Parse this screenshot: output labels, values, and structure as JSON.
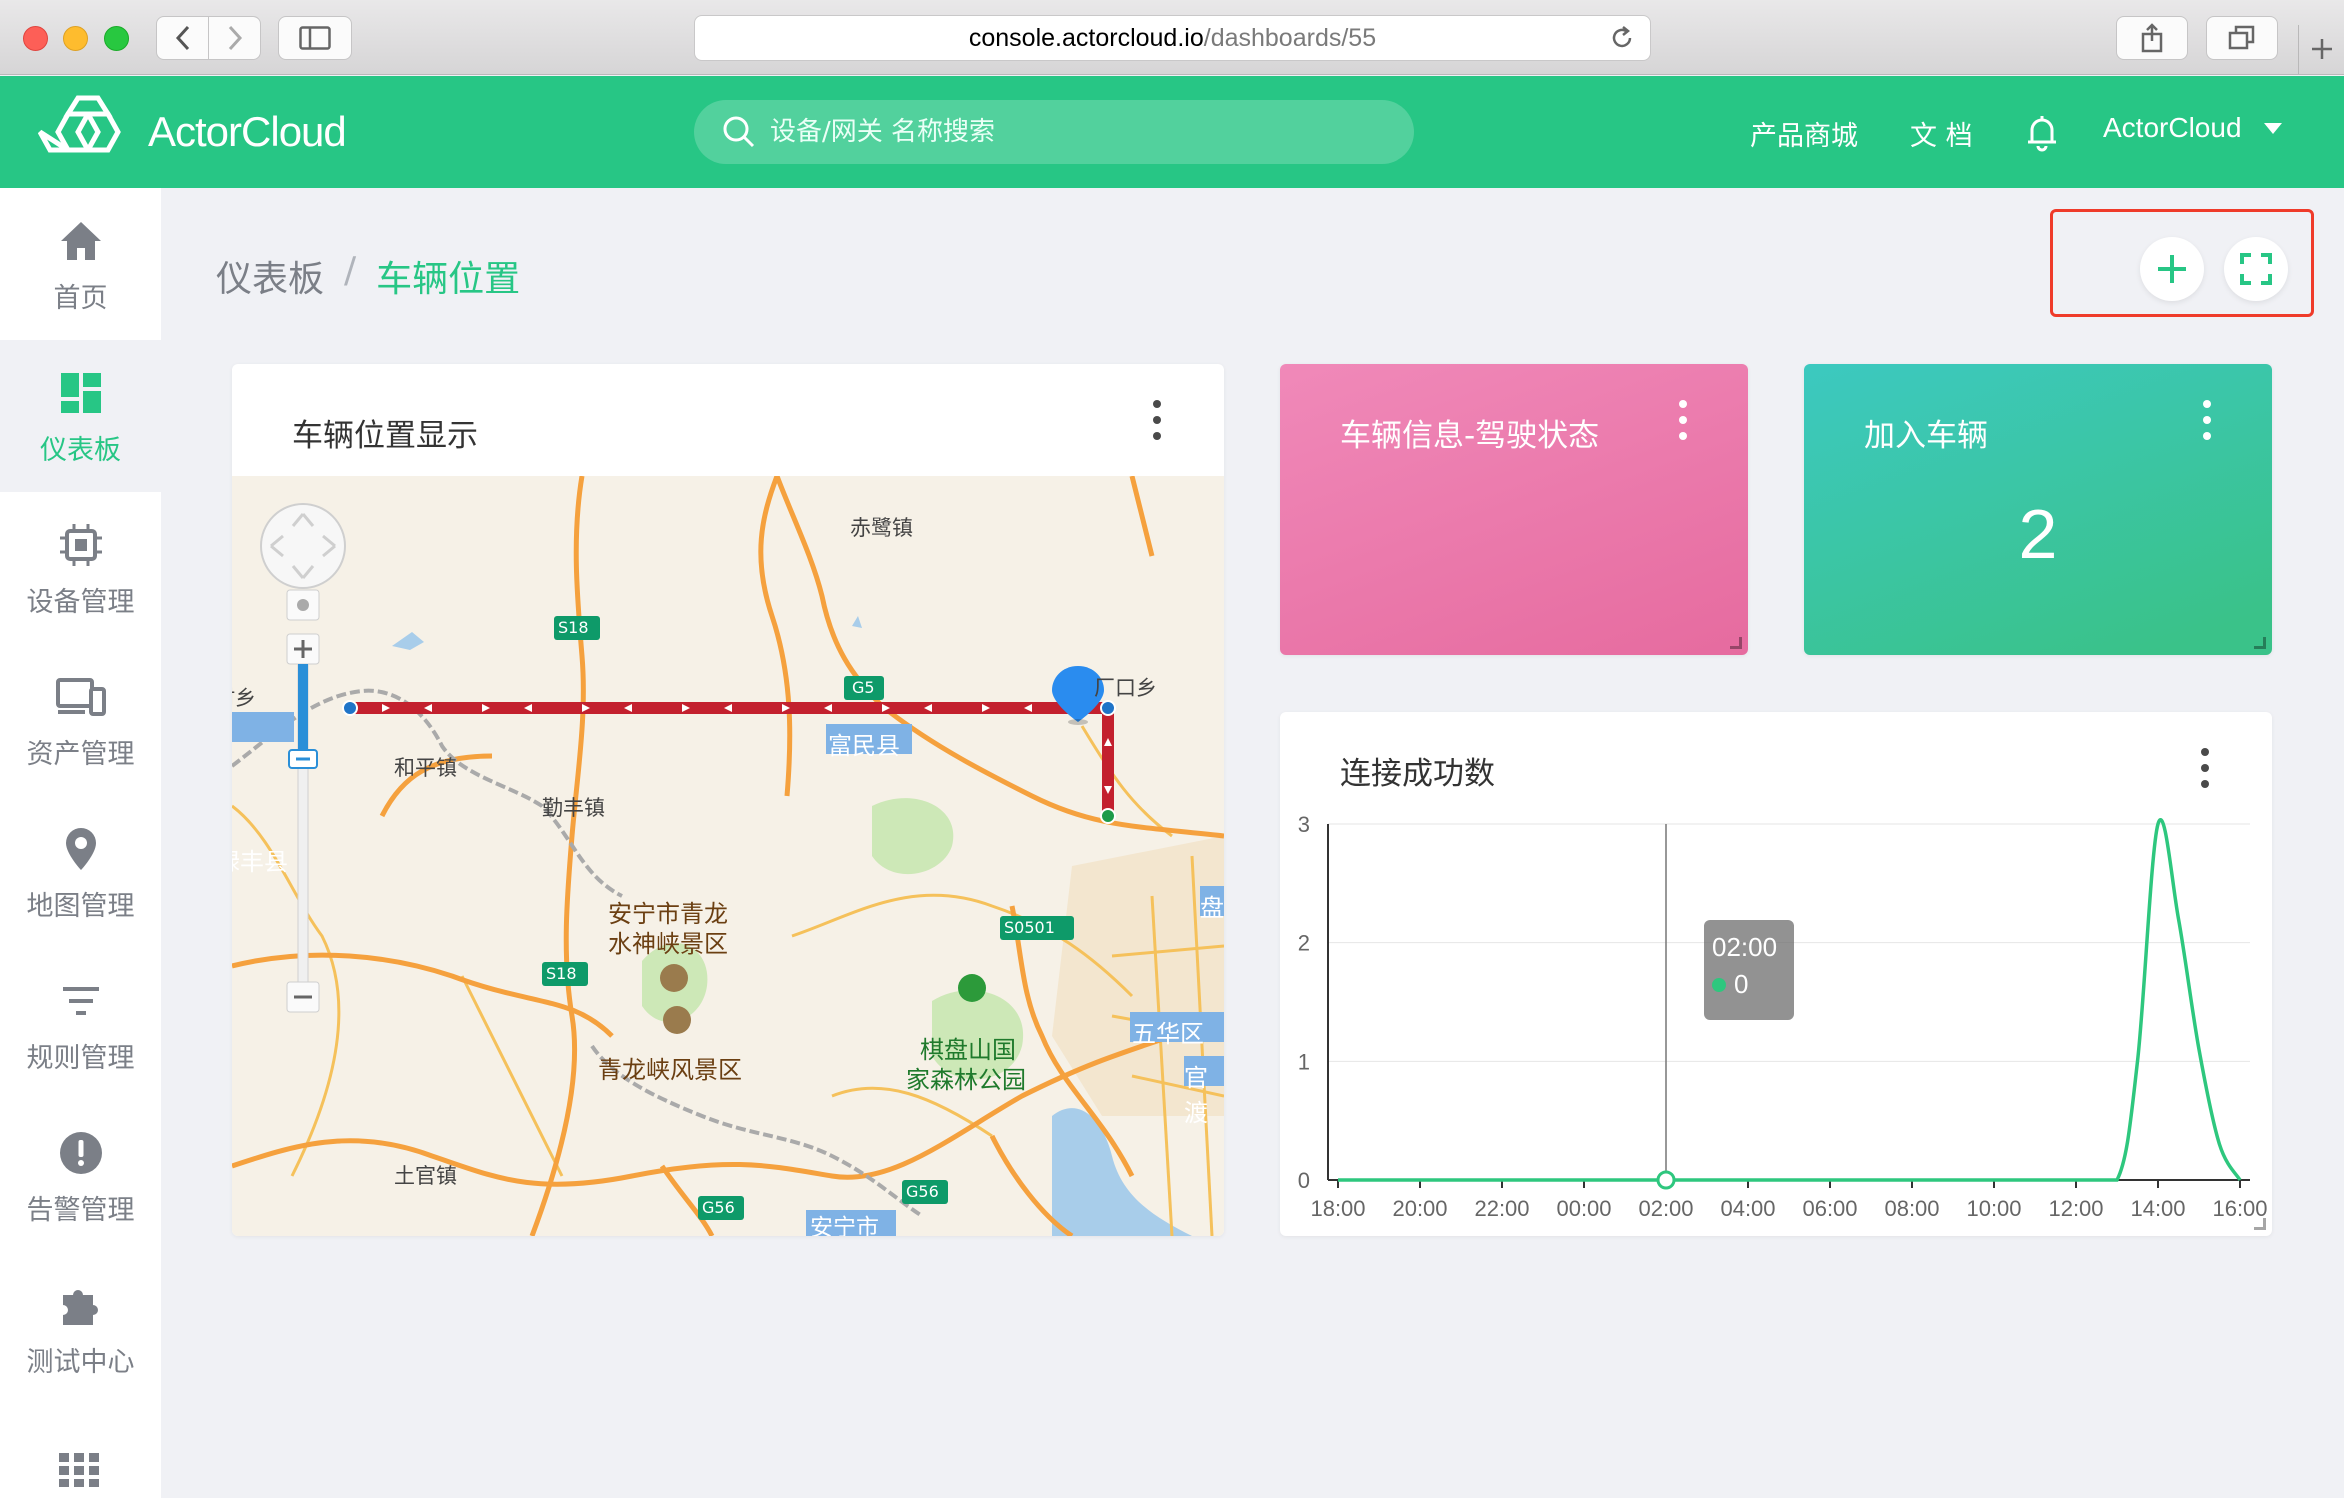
{
  "browser": {
    "url_host": "console.actorcloud.io",
    "url_path": "/dashboards/55"
  },
  "header": {
    "logo_text": "ActorCloud",
    "search_placeholder": "设备/网关 名称搜索",
    "links": [
      "产品商城",
      "文 档"
    ],
    "user": "ActorCloud"
  },
  "sidebar": {
    "items": [
      {
        "label": "首页",
        "icon": "home-icon"
      },
      {
        "label": "仪表板",
        "icon": "dashboard-icon",
        "active": true
      },
      {
        "label": "设备管理",
        "icon": "chip-icon"
      },
      {
        "label": "资产管理",
        "icon": "devices-icon"
      },
      {
        "label": "地图管理",
        "icon": "map-pin-icon"
      },
      {
        "label": "规则管理",
        "icon": "filter-icon"
      },
      {
        "label": "告警管理",
        "icon": "alert-icon"
      },
      {
        "label": "测试中心",
        "icon": "puzzle-icon"
      }
    ]
  },
  "breadcrumb": {
    "root": "仪表板",
    "separator": "/",
    "current": "车辆位置"
  },
  "widgets": {
    "map": {
      "title": "车辆位置显示",
      "labels": {
        "chilu": "赤鹭镇",
        "changkou": "厂口乡",
        "cunxiang": "村乡",
        "heping": "和平镇",
        "qinfeng": "勤丰镇",
        "lufeng": "禄丰县",
        "fumin": "富民县",
        "anning_scenic_1": "安宁市青龙",
        "anning_scenic_2": "水神峡景区",
        "qinglong": "青龙峡风景区",
        "qipan_1": "棋盘山国",
        "qipan_2": "家森林公园",
        "wuhua": "五华区",
        "panlong": "盘",
        "guandu": "官渡",
        "tuguan": "土官镇",
        "anning": "安宁市",
        "s18a": "S18",
        "s18b": "S18",
        "g5": "G5",
        "s0501": "S0501",
        "g56a": "G56",
        "g56b": "G56"
      }
    },
    "driving_status": {
      "title": "车辆信息-驾驶状态"
    },
    "add_vehicle": {
      "title": "加入车辆",
      "value": "2"
    },
    "connections": {
      "title": "连接成功数",
      "tooltip": {
        "time": "02:00",
        "value": "0"
      }
    }
  },
  "colors": {
    "brand": "#27c685",
    "pink": "#ec7aad",
    "teal": "#3cc6a9",
    "line": "#2ec77e",
    "route": "#c3202e",
    "highlight": "#ef3b2a"
  },
  "chart_data": {
    "type": "line",
    "title": "连接成功数",
    "x": [
      "18:00",
      "19:00",
      "20:00",
      "21:00",
      "22:00",
      "23:00",
      "00:00",
      "01:00",
      "02:00",
      "03:00",
      "04:00",
      "05:00",
      "06:00",
      "07:00",
      "08:00",
      "09:00",
      "10:00",
      "11:00",
      "12:00",
      "13:00",
      "13:30",
      "14:00",
      "14:30",
      "15:00",
      "15:30",
      "16:00"
    ],
    "series": [
      {
        "values": [
          0,
          0,
          0,
          0,
          0,
          0,
          0,
          0,
          0,
          0,
          0,
          0,
          0,
          0,
          0,
          0,
          0,
          0,
          0,
          0,
          1,
          3,
          2.2,
          1.1,
          0.3,
          0
        ]
      }
    ],
    "x_ticks": [
      "18:00",
      "20:00",
      "22:00",
      "00:00",
      "02:00",
      "04:00",
      "06:00",
      "08:00",
      "10:00",
      "12:00",
      "14:00",
      "16:00"
    ],
    "y_ticks": [
      "0",
      "1",
      "2",
      "3"
    ],
    "ylim": [
      0,
      3
    ],
    "grid": true
  }
}
